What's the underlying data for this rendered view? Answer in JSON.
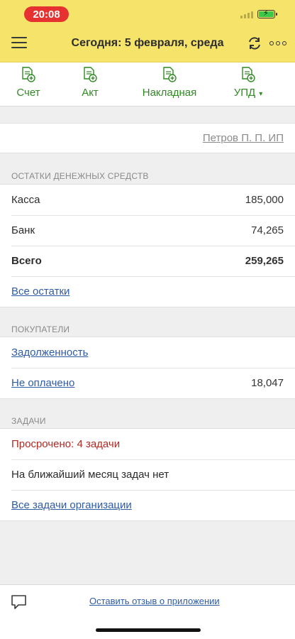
{
  "status_bar": {
    "time": "20:08"
  },
  "header": {
    "title": "Сегодня: 5 февраля, среда"
  },
  "toolbar": {
    "items": [
      {
        "label": "Счет"
      },
      {
        "label": "Акт"
      },
      {
        "label": "Накладная"
      },
      {
        "label": "УПД",
        "caret": "▾"
      }
    ]
  },
  "organization": {
    "name": "Петров П. П. ИП"
  },
  "cash": {
    "title": "ОСТАТКИ ДЕНЕЖНЫХ СРЕДСТВ",
    "rows": [
      {
        "label": "Касса",
        "value": "185,000"
      },
      {
        "label": "Банк",
        "value": "74,265"
      },
      {
        "label": "Всего",
        "value": "259,265"
      }
    ],
    "all_link": "Все остатки"
  },
  "buyers": {
    "title": "ПОКУПАТЕЛИ",
    "debt_link": "Задолженность",
    "unpaid_link": "Не оплачено",
    "unpaid_value": "18,047"
  },
  "tasks": {
    "title": "ЗАДАЧИ",
    "overdue": "Просрочено: 4 задачи",
    "upcoming": "На ближайший месяц задач нет",
    "all_link": "Все задачи организации"
  },
  "footer": {
    "feedback_link": "Оставить отзыв о приложении"
  },
  "colors": {
    "header_bg": "#f5e36a",
    "accent_green": "#2f8a22",
    "link_blue": "#2f5ca6",
    "overdue_red": "#b02a24",
    "time_pill": "#e5312f"
  },
  "icons": {
    "menu": "hamburger-menu-icon",
    "sync": "sync-icon",
    "more": "more-options-icon",
    "document_add": "document-add-icon",
    "chat": "chat-bubble-icon"
  }
}
